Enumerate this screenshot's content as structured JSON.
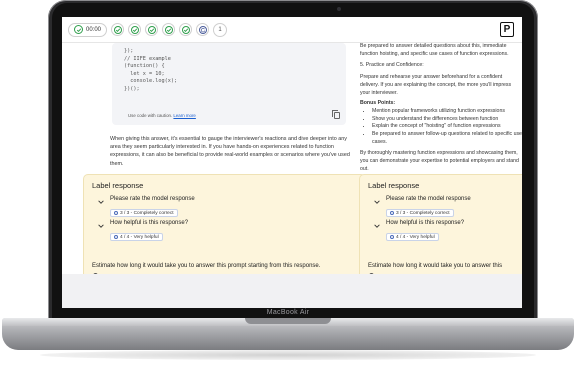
{
  "toolbar": {
    "timer": "00:00",
    "step_number": "1",
    "brand_letter": "P"
  },
  "code_block": {
    "lines": [
      "});",
      "",
      "// IIFE example",
      "(function() {",
      "  let x = 10;",
      "  console.log(x);",
      "})();"
    ],
    "caution_text": "Use code with caution.",
    "learn_more": "Learn more"
  },
  "response_left": {
    "paragraph": "When giving this answer, it's essential to gauge the interviewer's reactions and dive deeper into any area they seem particularly interested in. If you have hands-on experiences related to function expressions, it can also be beneficial to provide real-world examples or scenarios where you've used them."
  },
  "response_right": {
    "intro": "Be prepared to answer detailed questions about this, immediate function hoisting, and specific use cases of function expressions.",
    "section_title": "5. Practice and Confidence:",
    "practice_text": "Prepare and rehearse your answer beforehand for a confident delivery. If you are explaining the concept, the more you'll impress your interviewer.",
    "bonus_title": "Bonus Points:",
    "bullets": [
      "Mention popular frameworks utilizing function expressions",
      "Show you understand the differences between function",
      "Explain the concept of \"hoisting\" of function expressions",
      "Be prepared to answer follow-up questions related to specific use cases."
    ],
    "closing": "By thoroughly mastering function expressions and showcasing them, you can demonstrate your expertise to potential employers and stand out."
  },
  "label_panels": [
    {
      "title": "Label response",
      "rate_question": "Please rate the model response",
      "rate_value": "3 / 3 - Completely correct",
      "help_question": "How helpful is this response?",
      "help_value": "4 / 4 - Very helpful",
      "estimate_label": "Estimate how long it would take you to answer this prompt starting from this response."
    },
    {
      "title": "Label response",
      "rate_question": "Please rate the model response",
      "rate_value": "3 / 3 - Completely correct",
      "help_question": "How helpful is this response?",
      "help_value": "4 / 4 - Very helpful",
      "estimate_label": "Estimate how long it would take you to answer this"
    }
  ],
  "device": {
    "label": "MacBook Air"
  },
  "colors": {
    "check_green": "#2e9e4b",
    "panel_bg": "#fdf5dc",
    "link_blue": "#1a5fd1"
  }
}
